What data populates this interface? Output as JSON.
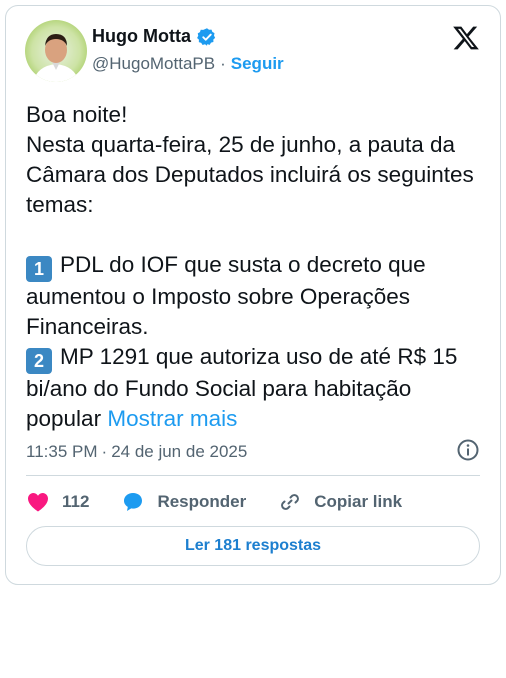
{
  "author": {
    "name": "Hugo Motta",
    "handle": "@HugoMottaPB",
    "separator": "·",
    "follow_label": "Seguir",
    "verified": true
  },
  "post": {
    "greeting": "Boa noite!",
    "intro": "Nesta quarta-feira, 25 de junho, a pauta da Câmara dos Deputados incluirá os seguintes temas:",
    "items": [
      {
        "number": "1",
        "text": "PDL do IOF que susta o decreto que aumentou o Imposto sobre Operações Financeiras."
      },
      {
        "number": "2",
        "text": "MP 1291 que autoriza uso de até R$ 15 bi/ano do Fundo Social para habitação popular"
      }
    ],
    "show_more": "Mostrar mais"
  },
  "meta": {
    "time": "11:35 PM",
    "separator": "·",
    "date": "24 de jun de 2025"
  },
  "actions": {
    "likes_count": "112",
    "reply_label": "Responder",
    "copy_link_label": "Copiar link"
  },
  "read_replies_label": "Ler 181 respostas",
  "colors": {
    "accent": "#1d9bf0",
    "like": "#f91880",
    "badge": "#3b88c3",
    "text_secondary": "#536471"
  },
  "icons": [
    "x-logo-icon",
    "verified-badge-icon",
    "heart-icon",
    "reply-bubble-icon",
    "link-icon",
    "info-icon"
  ]
}
